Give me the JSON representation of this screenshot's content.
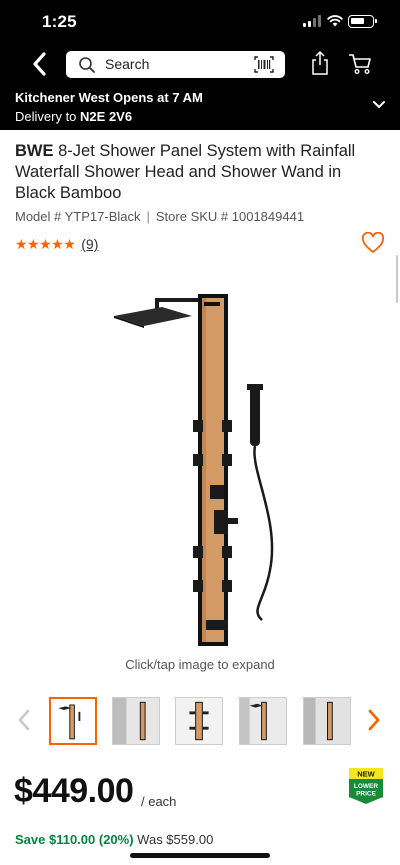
{
  "status": {
    "time": "1:25"
  },
  "header": {
    "search_placeholder": "Search",
    "icons": [
      "back-icon",
      "search-icon",
      "barcode-icon",
      "share-icon",
      "cart-icon"
    ]
  },
  "store": {
    "store_name": "Kitchener West",
    "hours": "Opens at 7 AM",
    "delivery_prefix": "Delivery to",
    "postal_code": "N2E 2V6"
  },
  "product": {
    "brand": "BWE",
    "title": "8-Jet Shower Panel System with Rainfall Waterfall Shower Head and Shower Wand in Black Bamboo",
    "model_label": "Model # YTP17-Black",
    "sku_label": "Store SKU # 1001849441",
    "stars": "★★★★★",
    "rating": 5,
    "review_count": "(9)",
    "expand_hint": "Click/tap image to expand"
  },
  "gallery": {
    "thumbnail_count": 5,
    "selected_index": 0
  },
  "pricing": {
    "price": "$449.00",
    "unit": "/ each",
    "save_text": "Save $110.00 (20%)",
    "was_text": "Was $559.00",
    "badge_line1": "NEW",
    "badge_line2": "LOWER",
    "badge_line3": "PRICE"
  },
  "colors": {
    "accent": "#f96302",
    "header_bg": "#000000",
    "save_green": "#00873c",
    "badge_green": "#1a8a3a",
    "badge_yellow": "#f5e61b"
  }
}
